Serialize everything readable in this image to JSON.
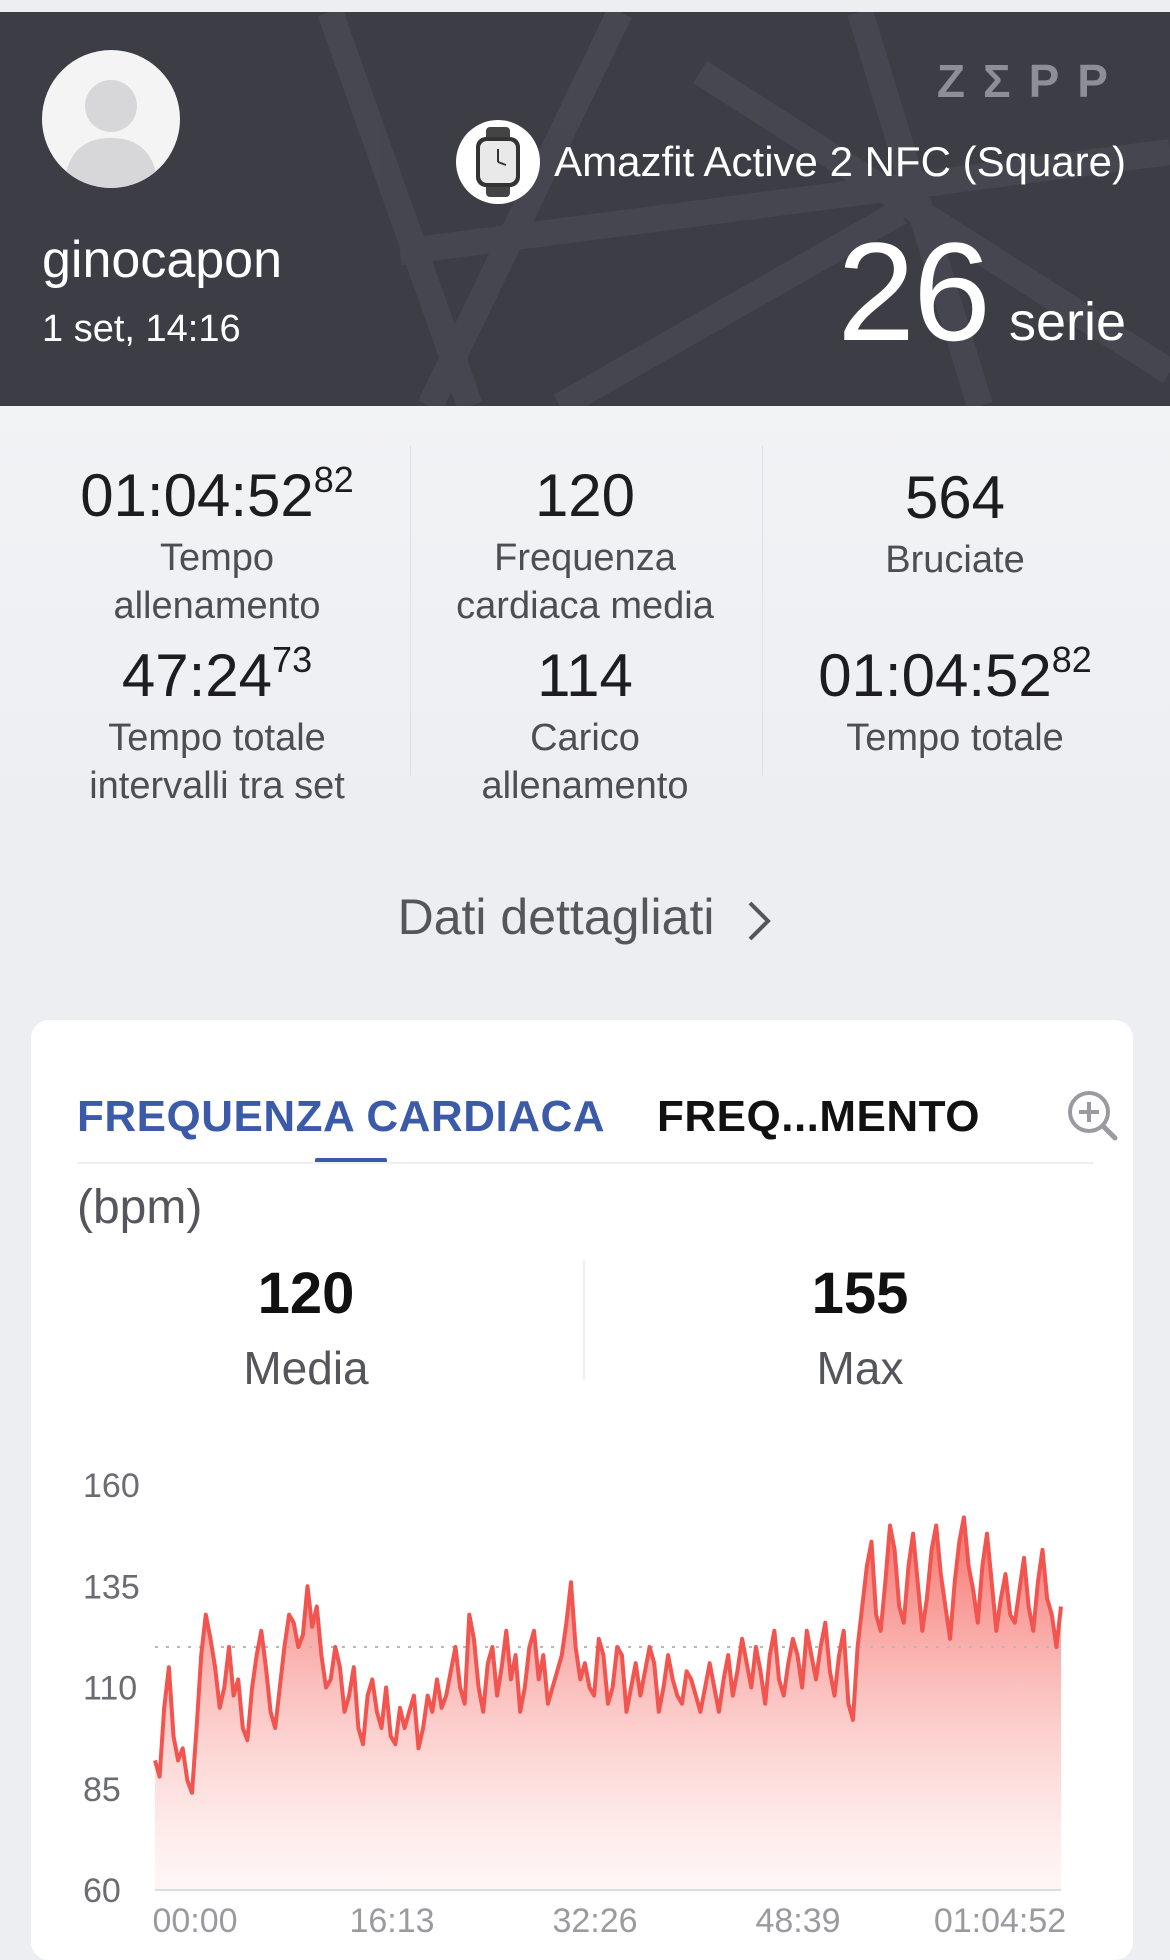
{
  "header": {
    "brand": "ZΣPP",
    "device_name": "Amazfit Active 2 NFC (Square)",
    "username": "ginocapon",
    "date": "1 set, 14:16",
    "series_count": "26",
    "series_unit": "serie"
  },
  "stats": {
    "training_time": {
      "main": "01:04:52",
      "sup": "82",
      "label1": "Tempo",
      "label2": "allenamento"
    },
    "avg_hr": {
      "main": "120",
      "label1": "Frequenza",
      "label2": "cardiaca media"
    },
    "burned": {
      "main": "564",
      "label1": "Bruciate"
    },
    "rest_time": {
      "main": "47:24",
      "sup": "73",
      "label1": "Tempo totale",
      "label2": "intervalli tra set"
    },
    "load": {
      "main": "114",
      "label1": "Carico",
      "label2": "allenamento"
    },
    "total_time": {
      "main": "01:04:52",
      "sup": "82",
      "label1": "Tempo totale"
    }
  },
  "detail_link": "Dati dettagliati",
  "card": {
    "tab_active": "FREQUENZA CARDIACA",
    "tab_other": "FREQ...MENTO",
    "unit": "(bpm)",
    "avg_value": "120",
    "avg_label": "Media",
    "max_value": "155",
    "max_label": "Max"
  },
  "colors": {
    "accent": "#3b5ba9",
    "header_bg": "#3c3d45",
    "line": "#f2544f"
  },
  "chart_data": {
    "type": "area",
    "ylim": [
      60,
      160
    ],
    "yticks": [
      "160",
      "135",
      "110",
      "85",
      "60"
    ],
    "xticks": [
      "00:00",
      "16:13",
      "32:26",
      "48:39",
      "01:04:52"
    ],
    "average_line": 120,
    "values": [
      92,
      88,
      105,
      115,
      98,
      92,
      95,
      87,
      84,
      100,
      118,
      128,
      122,
      115,
      105,
      110,
      120,
      108,
      112,
      100,
      97,
      110,
      118,
      124,
      115,
      104,
      100,
      110,
      120,
      128,
      126,
      120,
      123,
      135,
      125,
      130,
      118,
      110,
      112,
      120,
      115,
      104,
      108,
      115,
      100,
      96,
      108,
      112,
      104,
      100,
      110,
      98,
      96,
      105,
      100,
      104,
      108,
      95,
      100,
      108,
      104,
      112,
      105,
      108,
      114,
      120,
      110,
      106,
      128,
      122,
      110,
      104,
      116,
      120,
      108,
      115,
      124,
      112,
      118,
      104,
      110,
      120,
      124,
      112,
      118,
      106,
      110,
      114,
      118,
      126,
      136,
      120,
      112,
      116,
      110,
      108,
      122,
      118,
      106,
      110,
      120,
      118,
      104,
      110,
      116,
      108,
      114,
      120,
      116,
      104,
      110,
      118,
      112,
      108,
      106,
      114,
      112,
      108,
      104,
      110,
      116,
      110,
      104,
      112,
      118,
      108,
      114,
      122,
      116,
      110,
      120,
      114,
      106,
      118,
      124,
      112,
      108,
      116,
      122,
      118,
      110,
      124,
      118,
      112,
      120,
      126,
      114,
      108,
      118,
      124,
      106,
      102,
      120,
      130,
      140,
      146,
      128,
      124,
      136,
      150,
      144,
      130,
      126,
      140,
      148,
      136,
      124,
      132,
      144,
      150,
      138,
      130,
      122,
      136,
      146,
      152,
      140,
      134,
      126,
      140,
      148,
      136,
      124,
      132,
      138,
      128,
      126,
      134,
      142,
      130,
      124,
      136,
      144,
      132,
      128,
      120,
      130
    ]
  }
}
